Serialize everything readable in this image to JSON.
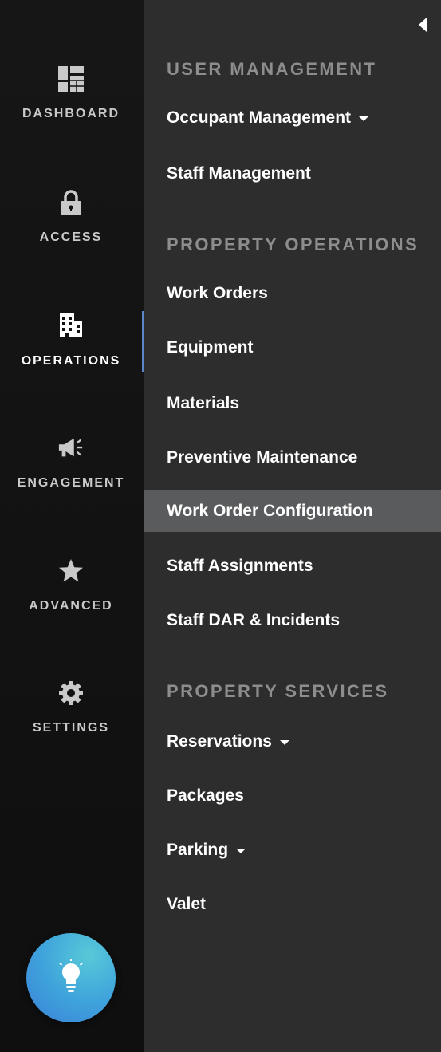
{
  "rail": {
    "items": [
      {
        "label": "DASHBOARD",
        "icon": "dashboard-icon"
      },
      {
        "label": "ACCESS",
        "icon": "lock-icon"
      },
      {
        "label": "OPERATIONS",
        "icon": "building-icon",
        "active": true
      },
      {
        "label": "ENGAGEMENT",
        "icon": "megaphone-icon"
      },
      {
        "label": "ADVANCED",
        "icon": "star-icon"
      },
      {
        "label": "SETTINGS",
        "icon": "gear-icon"
      }
    ],
    "fab_icon": "lightbulb-icon"
  },
  "panel": {
    "collapse_icon": "collapse-left-icon",
    "sections": [
      {
        "title": "USER MANAGEMENT",
        "items": [
          {
            "label": "Occupant Management",
            "has_dropdown": true
          },
          {
            "label": "Staff Management"
          }
        ]
      },
      {
        "title": "PROPERTY OPERATIONS",
        "items": [
          {
            "label": "Work Orders"
          },
          {
            "label": "Equipment"
          },
          {
            "label": "Materials"
          },
          {
            "label": "Preventive Maintenance"
          },
          {
            "label": "Work Order Configuration",
            "selected": true
          },
          {
            "label": "Staff Assignments"
          },
          {
            "label": "Staff DAR & Incidents"
          }
        ]
      },
      {
        "title": "PROPERTY SERVICES",
        "items": [
          {
            "label": "Reservations",
            "has_dropdown": true
          },
          {
            "label": "Packages"
          },
          {
            "label": "Parking",
            "has_dropdown": true
          },
          {
            "label": "Valet"
          }
        ]
      }
    ]
  },
  "colors": {
    "rail_bg": "#111111",
    "panel_bg": "#2d2d2e",
    "selected_bg": "#5a5b5c",
    "section_title": "#8d8d8d",
    "active_indicator": "#5b86c9",
    "fab_gradient_start": "#58c9d8",
    "fab_gradient_end": "#3a7fd8"
  }
}
